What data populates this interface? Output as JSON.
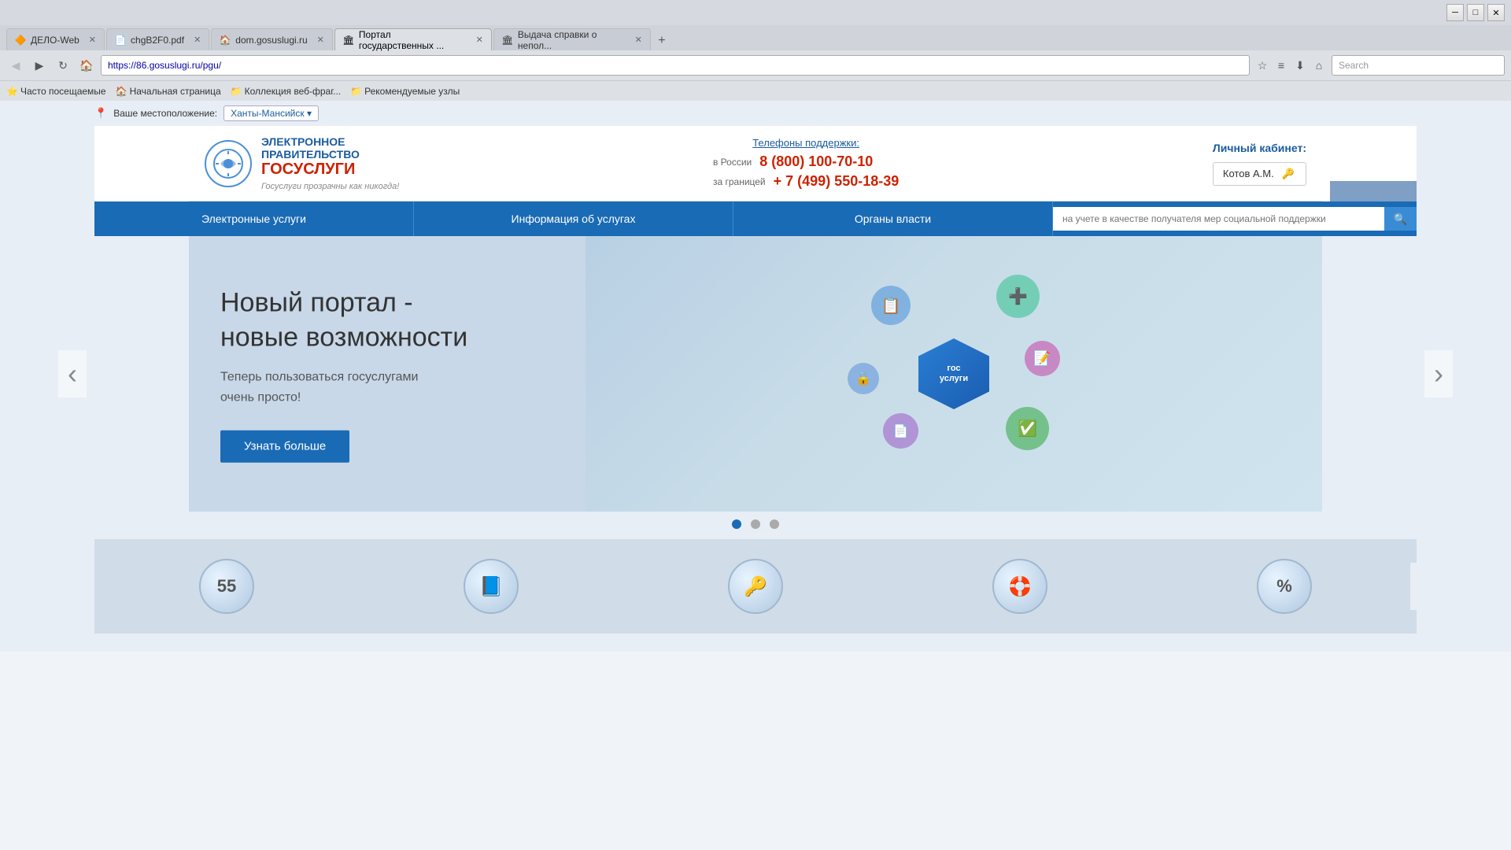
{
  "browser": {
    "tabs": [
      {
        "id": "tab1",
        "title": "ДЕЛО-Web",
        "url": "",
        "active": false,
        "favicon": "📄"
      },
      {
        "id": "tab2",
        "title": "chgB2F0.pdf",
        "url": "",
        "active": false,
        "favicon": "📄"
      },
      {
        "id": "tab3",
        "title": "dom.gosuslugi.ru",
        "url": "",
        "active": false,
        "favicon": "🏠"
      },
      {
        "id": "tab4",
        "title": "Портал государственных ...",
        "url": "https://86.gosuslugi.ru/pgu/",
        "active": true,
        "favicon": "🏛"
      },
      {
        "id": "tab5",
        "title": "Выдача справки о непол...",
        "url": "",
        "active": false,
        "favicon": "🏛"
      }
    ],
    "url": "https://86.gosuslugi.ru/pgu/",
    "search_placeholder": "Search",
    "bookmarks": [
      {
        "label": "Часто посещаемые"
      },
      {
        "label": "Начальная страница"
      },
      {
        "label": "Коллекция веб-фраг..."
      },
      {
        "label": "Рекомендуемые узлы"
      }
    ]
  },
  "location": {
    "label": "Ваше местоположение:",
    "city": "Ханты-Мансийск ▾"
  },
  "header": {
    "logo_line1": "ЭЛЕКТРОННОЕ",
    "logo_line2": "ПРАВИТЕЛЬСТВО",
    "logo_brand": "ГОСУСЛУГИ",
    "logo_tagline": "Госуслуги прозрачны как никогда!",
    "phones_title": "Телефоны поддержки:",
    "phone_russia_label": "в России",
    "phone_russia": "8 (800) 100-70-10",
    "phone_abroad_label": "за границей",
    "phone_abroad": "+ 7 (499) 550-18-39",
    "account_title": "Личный кабинет:",
    "account_name": "Котов А.М."
  },
  "nav": {
    "items": [
      {
        "label": "Электронные услуги"
      },
      {
        "label": "Информация об услугах"
      },
      {
        "label": "Органы власти"
      }
    ],
    "search_placeholder": "на учете в качестве получателя мер социальной поддержки"
  },
  "banner": {
    "title_line1": "Новый портал -",
    "title_line2": "новые возможности",
    "subtitle_line1": "Теперь пользоваться госуслугами",
    "subtitle_line2": "очень просто!",
    "button_label": "Узнать больше"
  },
  "bottom_icons": [
    {
      "icon": "5️⃣5️⃣",
      "label": ""
    },
    {
      "icon": "📘",
      "label": ""
    },
    {
      "icon": "🔑",
      "label": ""
    },
    {
      "icon": "🛟",
      "label": ""
    },
    {
      "icon": "%",
      "label": ""
    }
  ],
  "outer_arrows": {
    "left": "‹",
    "right": "›"
  }
}
